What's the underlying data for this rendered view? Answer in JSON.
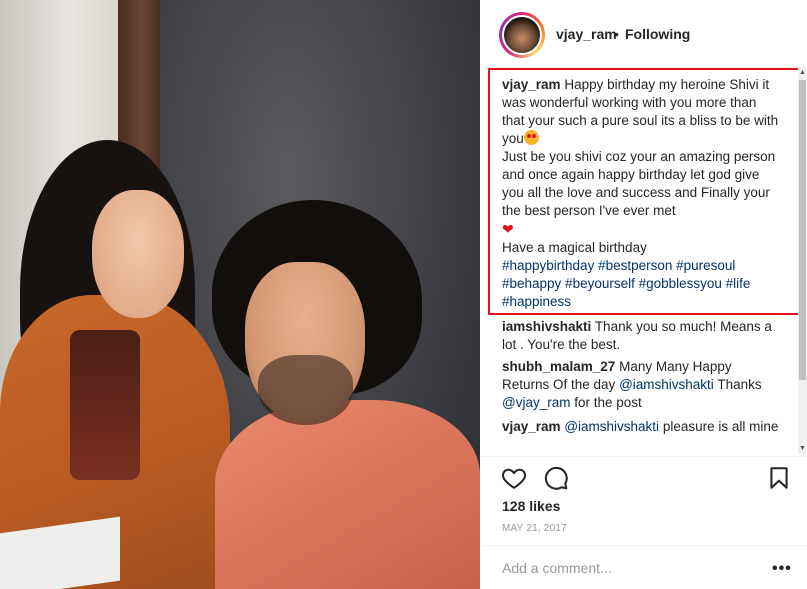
{
  "post": {
    "author": "vjay_ram",
    "separator": "•",
    "follow_status": "Following"
  },
  "caption": {
    "user": "vjay_ram",
    "line1": "Happy birthday my heroine Shivi it was wonderful working with you more than that your such a pure soul its a bliss to be with you",
    "line2": "Just be you shivi coz your an amazing person and once again happy birthday let god give you all the love and success and Finally your the best person I've ever met",
    "heart_emoji": "❤",
    "line3": "Have a magical birthday",
    "hashtags": "#happybirthday #bestperson #puresoul #behappy #beyourself #gobblessyou #life #happiness"
  },
  "comments": [
    {
      "user": "iamshivshakti",
      "text": "Thank you so much! Means a lot . You're the best."
    },
    {
      "user": "shubh_malam_27",
      "text_before": "Many Many Happy Returns Of the day",
      "mention1": "@iamshivshakti",
      "text_mid": "Thanks",
      "mention2": "@vjay_ram",
      "text_after": "for the post"
    },
    {
      "user": "vjay_ram",
      "mention": "@iamshivshakti",
      "text": "pleasure is all mine"
    }
  ],
  "likes": "128 likes",
  "date": "MAY 21, 2017",
  "add_comment": {
    "placeholder": "Add a comment..."
  },
  "more_label": "•••",
  "scroll_up": "▲",
  "scroll_down": "▼",
  "colors": {
    "highlight_border": "#e0121b",
    "link": "#003569",
    "muted": "#999999"
  },
  "icons": [
    "heart-icon",
    "comment-icon",
    "bookmark-icon",
    "more-options-icon"
  ]
}
